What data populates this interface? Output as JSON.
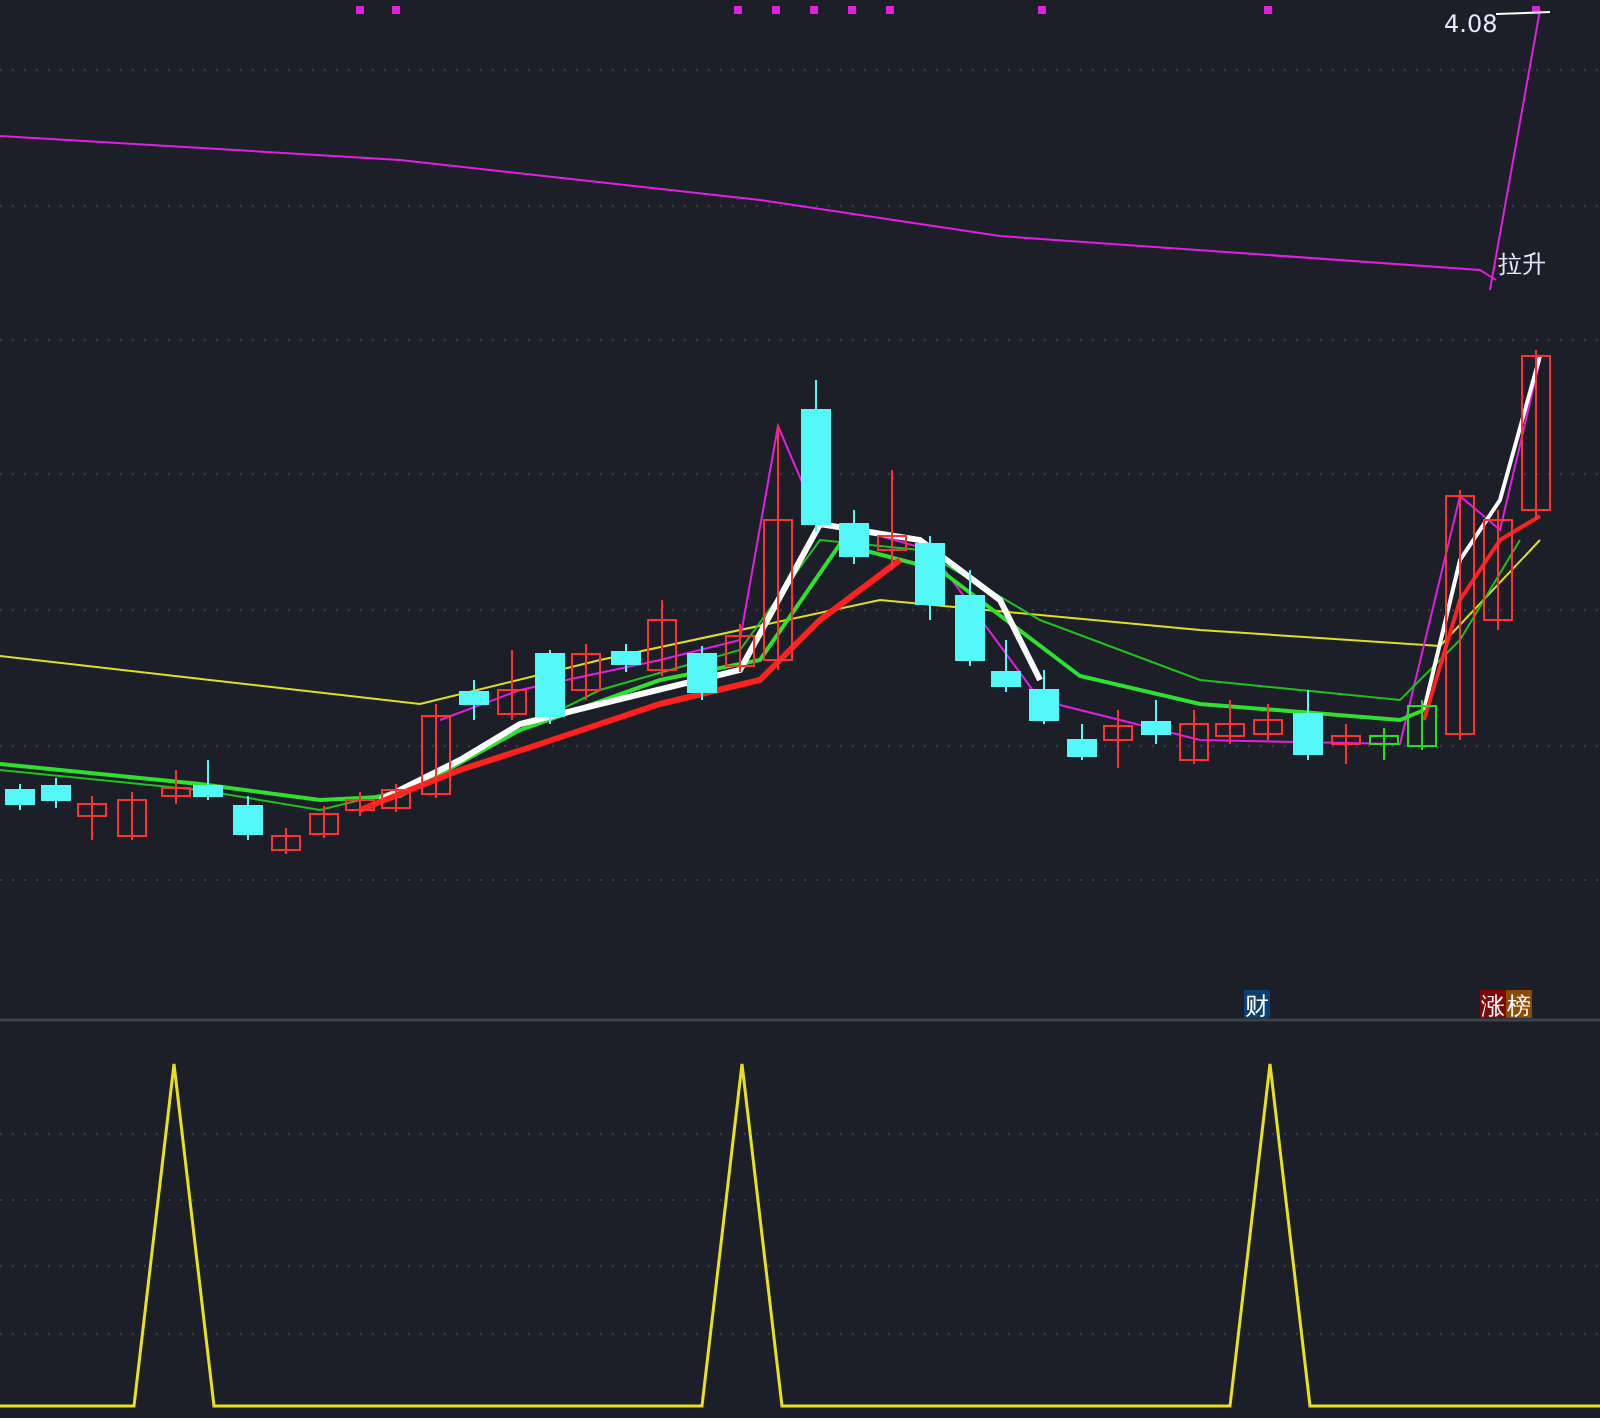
{
  "main_chart": {
    "price_label": "4.08",
    "annotation": "拉升"
  },
  "badges": [
    {
      "text": "财",
      "color": "#0b3f73"
    },
    {
      "text": "涨",
      "color": "#7d0a0a"
    },
    {
      "text": "榜",
      "color": "#8c4a06"
    }
  ]
}
